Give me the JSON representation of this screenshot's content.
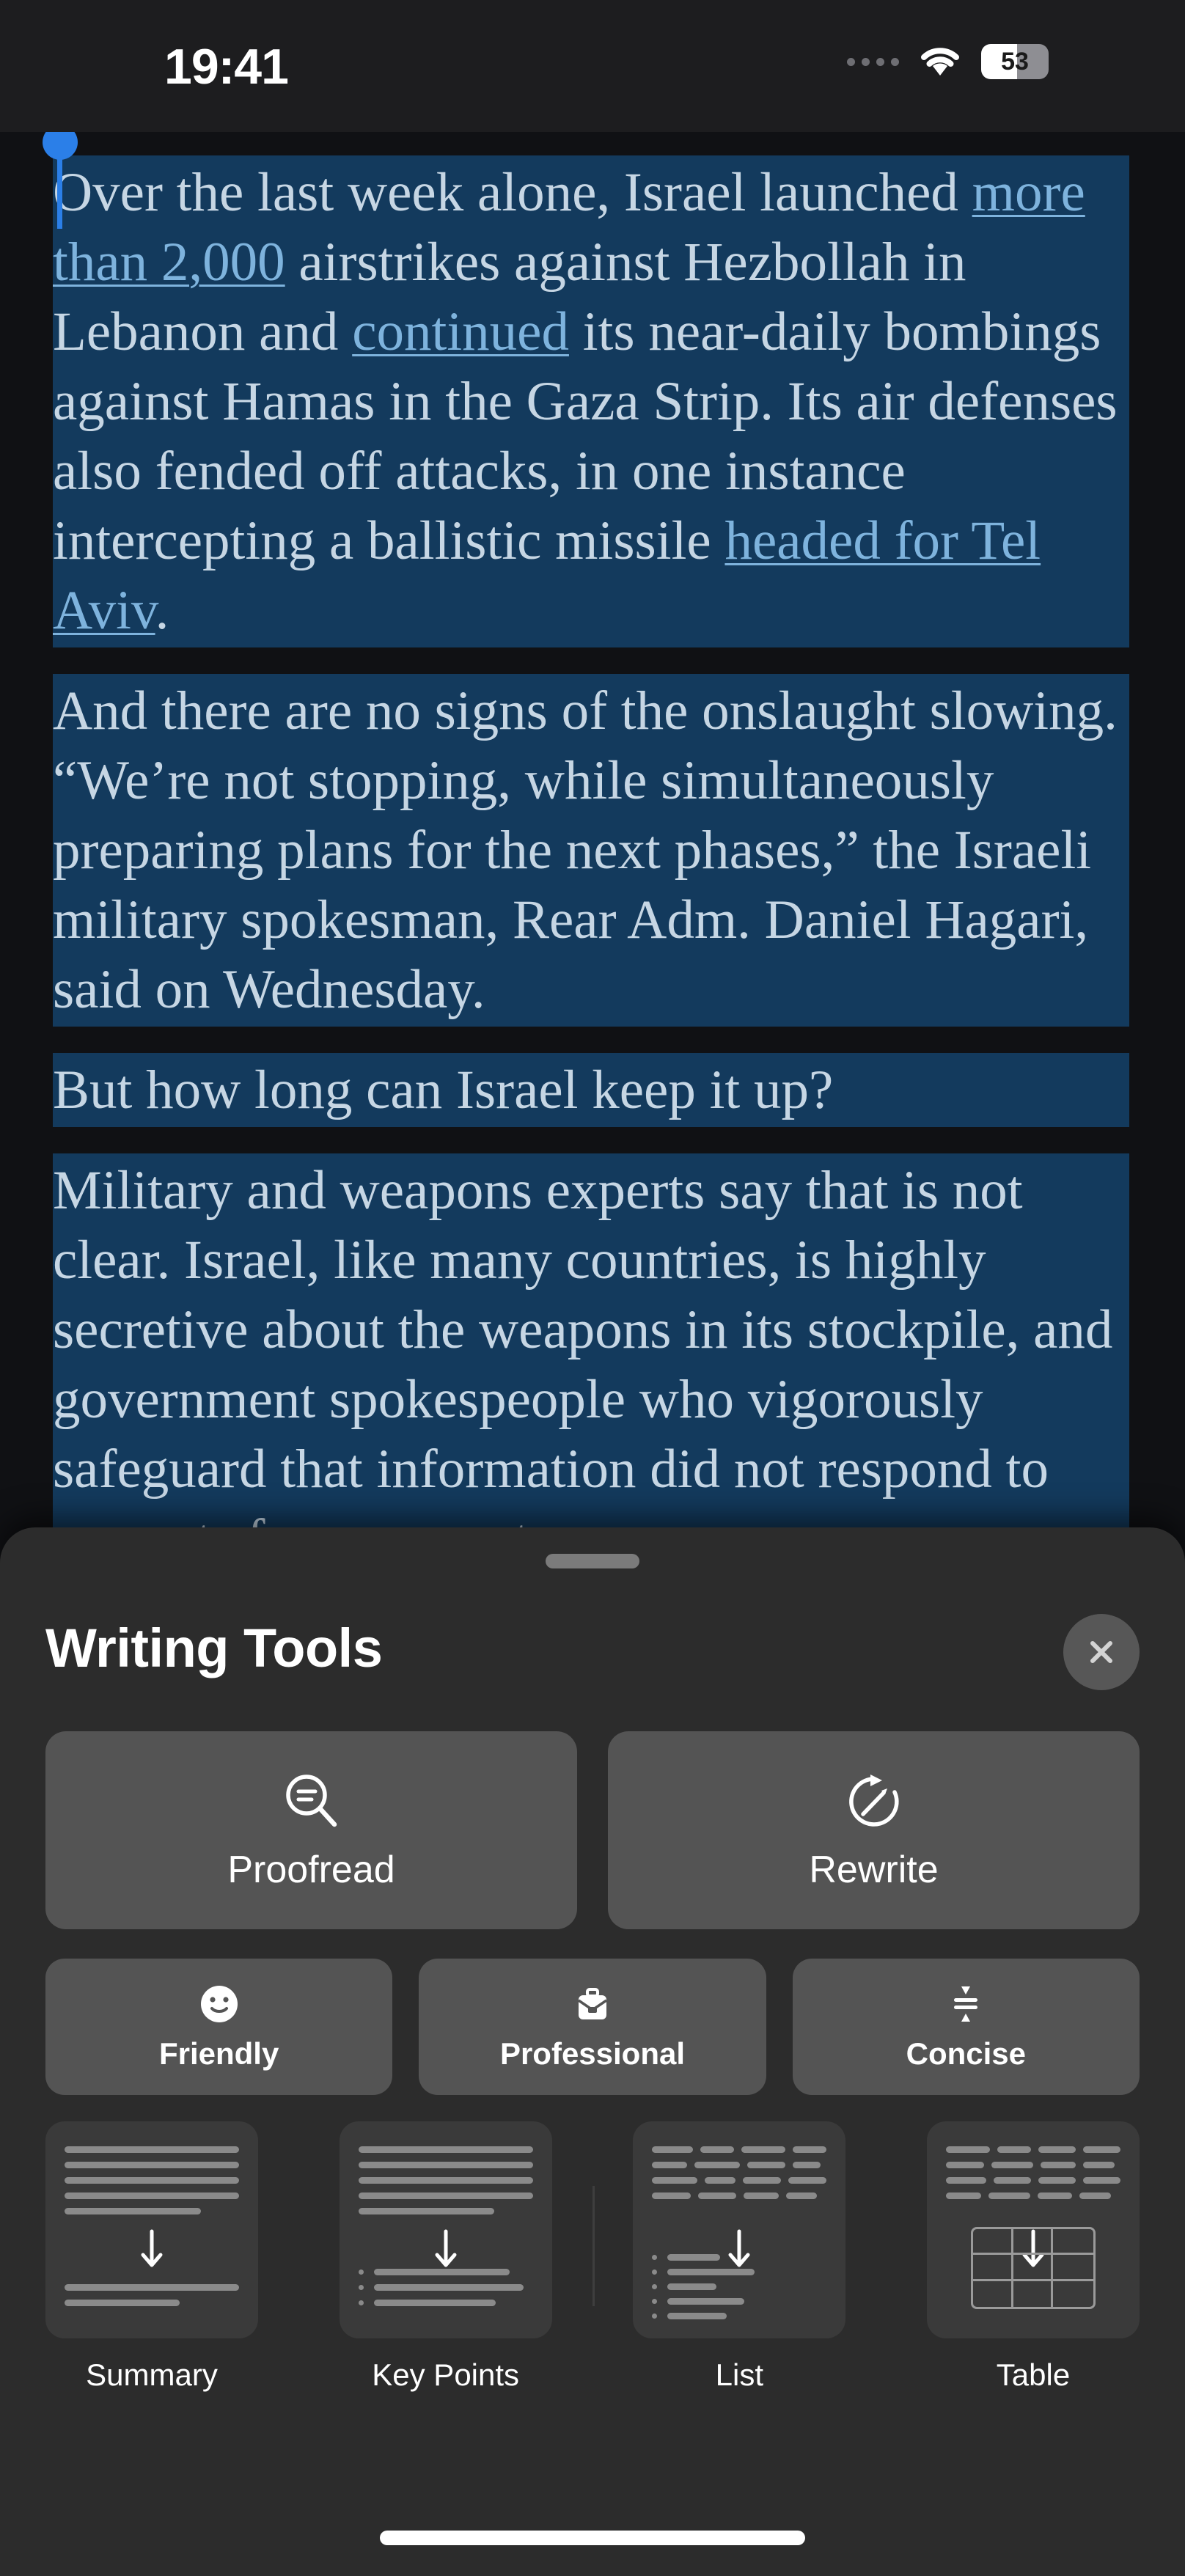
{
  "status_bar": {
    "time": "19:41",
    "battery_percent": "53",
    "battery_level": 53,
    "wifi_icon": "wifi-icon",
    "dots_icon": "signal-dots-icon"
  },
  "article": {
    "selection_color": "#133a5d",
    "text_color": "#c6d6e4",
    "link_color": "#7eb3dd",
    "paragraphs": [
      {
        "segments": [
          {
            "type": "text",
            "text": "Over the last week alone, Israel launched "
          },
          {
            "type": "link",
            "text": "more than 2,000"
          },
          {
            "type": "text",
            "text": " airstrikes against Hezbollah in Lebanon and "
          },
          {
            "type": "link",
            "text": "continued"
          },
          {
            "type": "text",
            "text": " its near-daily bombings against Hamas in the Gaza Strip. Its air defenses also fended off attacks, in one instance intercepting a ballistic missile "
          },
          {
            "type": "link",
            "text": "headed for Tel Aviv"
          },
          {
            "type": "text",
            "text": "."
          }
        ]
      },
      {
        "segments": [
          {
            "type": "text",
            "text": "And there are no signs of the onslaught slowing. “We’re not stopping, while simultaneously preparing plans for the next phases,” the Israeli military spokesman, Rear Adm. Daniel Hagari, said on Wednesday."
          }
        ]
      },
      {
        "segments": [
          {
            "type": "text",
            "text": "But how long can Israel keep it up?"
          }
        ]
      },
      {
        "segments": [
          {
            "type": "text",
            "text": "Military and weapons experts say that is not clear. Israel, like many countries, is highly secretive about the weapons in its stockpile, and government spokespeople who vigorously safeguard that information did not respond to requests for comment."
          }
        ]
      }
    ]
  },
  "writing_tools": {
    "title": "Writing Tools",
    "close_label": "Close",
    "grabber": "sheet-grabber",
    "primary_actions": [
      {
        "id": "proofread",
        "label": "Proofread",
        "icon": "magnifier-lines-icon"
      },
      {
        "id": "rewrite",
        "label": "Rewrite",
        "icon": "circular-arrow-pencil-icon"
      }
    ],
    "tone_actions": [
      {
        "id": "friendly",
        "label": "Friendly",
        "icon": "smiley-face-icon"
      },
      {
        "id": "professional",
        "label": "Professional",
        "icon": "briefcase-icon"
      },
      {
        "id": "concise",
        "label": "Concise",
        "icon": "compress-lines-icon"
      }
    ],
    "transform_actions": [
      {
        "id": "summary",
        "label": "Summary",
        "icon": "summary-card-icon"
      },
      {
        "id": "key_points",
        "label": "Key Points",
        "icon": "key-points-card-icon"
      },
      {
        "id": "list",
        "label": "List",
        "icon": "list-card-icon"
      },
      {
        "id": "table",
        "label": "Table",
        "icon": "table-card-icon"
      }
    ]
  },
  "colors": {
    "sheet_background": "#2c2c2c",
    "button_background": "#545454",
    "card_background": "#3a3a3a",
    "accent_blue": "#2b7fe8",
    "page_background": "#101114"
  },
  "home_indicator": "home-indicator"
}
